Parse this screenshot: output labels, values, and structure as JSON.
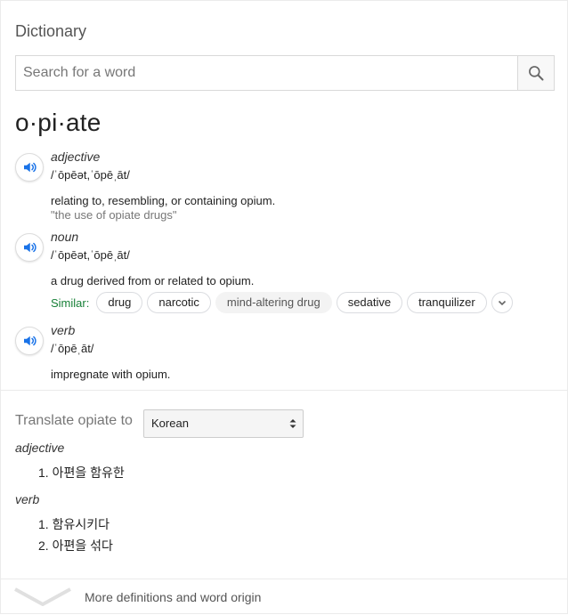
{
  "header": {
    "title": "Dictionary"
  },
  "search": {
    "placeholder": "Search for a word",
    "value": "",
    "icon": "search-icon"
  },
  "entry": {
    "headword": "o·pi·ate",
    "senses": [
      {
        "pos": "adjective",
        "phonetic": "/ˈōpēət,ˈōpēˌāt/",
        "definition": "relating to, resembling, or containing opium.",
        "example": "\"the use of opiate drugs\""
      },
      {
        "pos": "noun",
        "phonetic": "/ˈōpēət,ˈōpēˌāt/",
        "definition": "a drug derived from or related to opium.",
        "similar_label": "Similar:",
        "similar": [
          "drug",
          "narcotic",
          "mind-altering drug",
          "sedative",
          "tranquilizer"
        ]
      },
      {
        "pos": "verb",
        "phonetic": "/ˈōpēˌāt/",
        "definition": "impregnate with opium."
      }
    ]
  },
  "translate": {
    "label": "Translate opiate to",
    "language": "Korean",
    "groups": [
      {
        "pos": "adjective",
        "items": [
          "1. 아편을 함유한"
        ]
      },
      {
        "pos": "verb",
        "items": [
          "1. 함유시키다",
          "2. 아편을 섞다"
        ]
      }
    ]
  },
  "footer": {
    "more_label": "More definitions and word origin"
  },
  "colors": {
    "similar_label": "#188038",
    "speaker_icon": "#1a73e8"
  }
}
